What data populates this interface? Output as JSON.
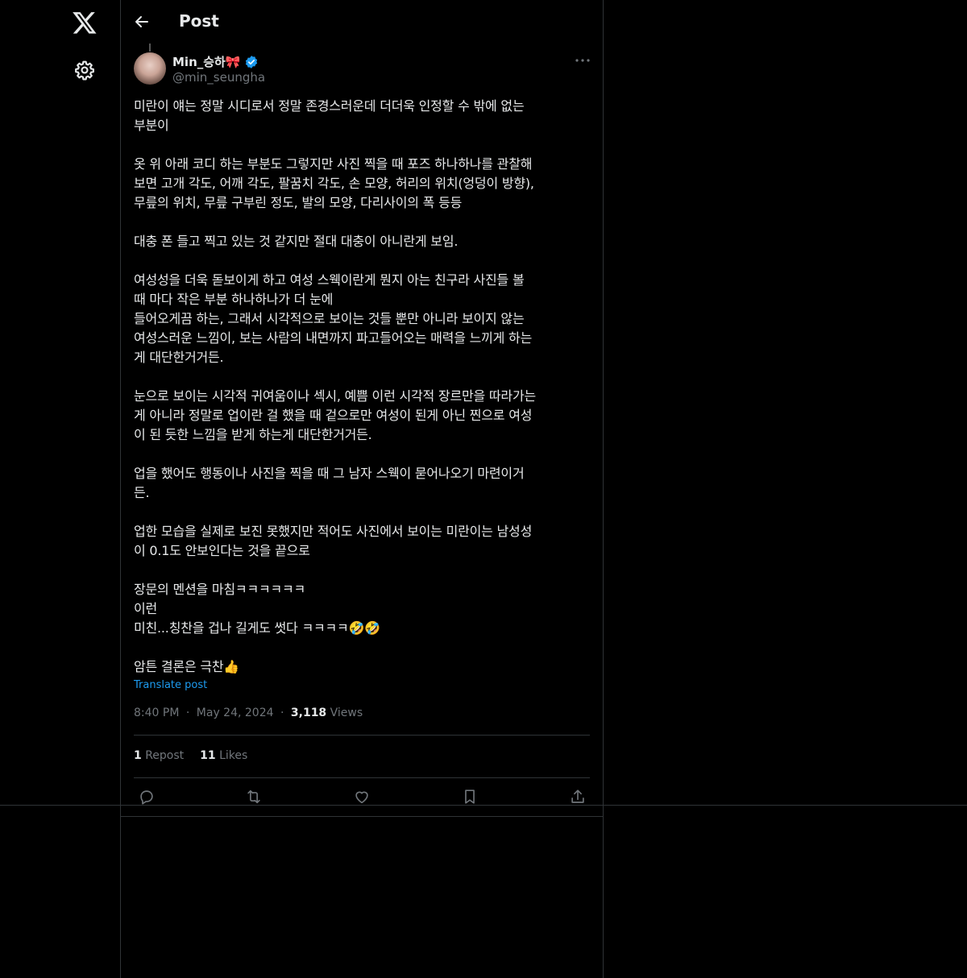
{
  "header": {
    "title": "Post"
  },
  "author": {
    "display_name": "Min_승하🎀",
    "handle": "@min_seungha"
  },
  "post": {
    "text": "미란이 얘는 정말 시디로서 정말 존경스러운데 더더욱 인정할 수 밖에 없는\n부분이\n\n옷 위 아래 코디 하는 부분도 그렇지만 사진 찍을 때 포즈 하나하나를 관찰해\n보면 고개 각도, 어깨 각도, 팔꿈치 각도, 손 모양, 허리의 위치(엉덩이 방향),\n무릎의 위치, 무릎 구부린 정도, 발의 모양, 다리사이의 폭 등등\n\n대충 폰 들고 찍고 있는 것 같지만 절대 대충이 아니란게 보임.\n\n여성성을 더욱 돋보이게 하고 여성 스웩이란게 뭔지 아는 친구라 사진들 볼\n때 마다 작은 부분 하나하나가 더 눈에\n들어오게끔 하는, 그래서 시각적으로 보이는 것들 뿐만 아니라 보이지 않는\n여성스러운 느낌이, 보는 사람의 내면까지 파고들어오는 매력을 느끼게 하는\n게 대단한거거든.\n\n눈으로 보이는 시각적 귀여움이나 섹시, 예쁨 이런 시각적 장르만을 따라가는\n게 아니라 정말로 업이란 걸 했을 때 겉으로만 여성이 된게 아닌 찐으로 여성\n이 된 듯한 느낌을 받게 하는게 대단한거거든.\n\n업을 했어도 행동이나 사진을 찍을 때 그 남자 스웩이 묻어나오기 마련이거\n든.\n\n업한 모습을 실제로 보진 못했지만 적어도 사진에서 보이는 미란이는 남성성\n이 0.1도 안보인다는 것을 끝으로\n\n장문의 멘션을 마침ㅋㅋㅋㅋㅋㅋ\n이런\n미친...칭찬을 겁나 길게도 썻다 ㅋㅋㅋㅋ🤣🤣\n\n암튼 결론은 극찬👍",
    "translate_label": "Translate post",
    "time": "8:40 PM",
    "date": "May 24, 2024",
    "views_count": "3,118",
    "views_label": "Views",
    "separator": "·"
  },
  "stats": {
    "reposts_count": "1",
    "reposts_label": "Repost",
    "likes_count": "11",
    "likes_label": "Likes"
  },
  "icons": {
    "logo": "x-logo-icon",
    "settings": "gear-icon",
    "back": "back-arrow-icon",
    "more": "more-dots-icon",
    "verified": "verified-badge-icon",
    "reply": "reply-icon",
    "repost": "repost-icon",
    "like": "heart-icon",
    "bookmark": "bookmark-icon",
    "share": "share-icon"
  },
  "colors": {
    "background": "#000000",
    "text": "#e7e9ea",
    "muted": "#71767b",
    "accent": "#1d9bf0",
    "border": "#2f3336"
  }
}
